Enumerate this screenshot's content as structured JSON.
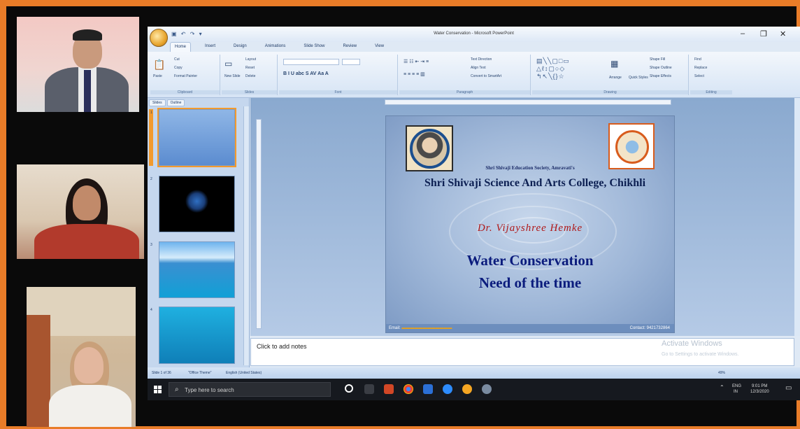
{
  "window": {
    "title": "Water Conservation - Microsoft PowerPoint",
    "controls": [
      "–",
      "❐",
      "✕"
    ]
  },
  "ribbon": {
    "tabs": [
      "Home",
      "Insert",
      "Design",
      "Animations",
      "Slide Show",
      "Review",
      "View"
    ],
    "active_tab": "Home",
    "clipboard": {
      "paste": "Paste",
      "cut": "Cut",
      "copy": "Copy",
      "format_painter": "Format Painter",
      "label": "Clipboard"
    },
    "slides": {
      "new_slide": "New Slide",
      "layout": "Layout",
      "reset": "Reset",
      "delete": "Delete",
      "label": "Slides"
    },
    "font": {
      "label": "Font"
    },
    "paragraph": {
      "text_direction": "Text Direction",
      "align_text": "Align Text",
      "convert_smartart": "Convert to SmartArt",
      "label": "Paragraph"
    },
    "drawing": {
      "arrange": "Arrange",
      "quick_styles": "Quick Styles",
      "shape_fill": "Shape Fill",
      "shape_outline": "Shape Outline",
      "shape_effects": "Shape Effects",
      "label": "Drawing"
    },
    "editing": {
      "find": "Find",
      "replace": "Replace",
      "select": "Select",
      "label": "Editing"
    }
  },
  "panel": {
    "tabs": [
      "Slides",
      "Outline"
    ],
    "slide_numbers": [
      "1",
      "2",
      "3",
      "4"
    ]
  },
  "slide": {
    "society": "Shri Shivaji Education Society, Amravati's",
    "college": "Shri Shivaji Science And Arts College, Chikhli",
    "author": "Dr. Vijayshree Hemke",
    "title_line1": "Water Conservation",
    "title_line2": "Need of the time",
    "footer_email_label": "Email:",
    "footer_contact": "Contact: 9421732864"
  },
  "notes": {
    "placeholder": "Click to add notes"
  },
  "watermark": {
    "line1": "Activate Windows",
    "line2": "Go to Settings to activate Windows."
  },
  "statusbar": {
    "slide_pos": "Slide 1 of 36",
    "theme": "\"Office Theme\"",
    "language": "English (United States)",
    "zoom": "49%"
  },
  "taskbar": {
    "search_placeholder": "Type here to search",
    "lang": "ENG",
    "lang2": "IN",
    "time": "9:01 PM",
    "date": "12/3/2020"
  },
  "colors": {
    "frame": "#e97c28",
    "slide_title": "#0b1c7d",
    "author": "#b01818"
  }
}
